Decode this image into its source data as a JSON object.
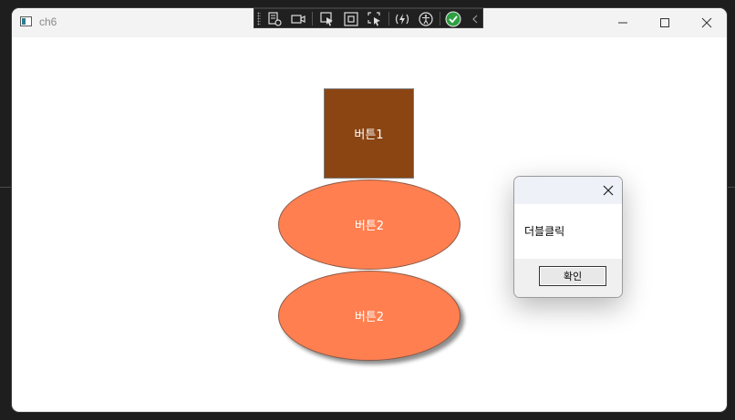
{
  "window": {
    "title": "ch6"
  },
  "toolbar": {
    "icons": [
      "grip-icon",
      "live-tree-icon",
      "video-icon",
      "select-element-icon",
      "layout-adorners-icon",
      "track-focus-icon",
      "hot-reload-icon",
      "accessibility-icon",
      "check-icon",
      "collapse-icon"
    ]
  },
  "content": {
    "button1_label": "버튼1",
    "button2_label": "버튼2",
    "button3_label": "버튼2"
  },
  "colors": {
    "button1_bg": "#8B4513",
    "ellipse_bg": "#FF7F50"
  },
  "dialog": {
    "message": "더블클릭",
    "ok_label": "확인"
  }
}
